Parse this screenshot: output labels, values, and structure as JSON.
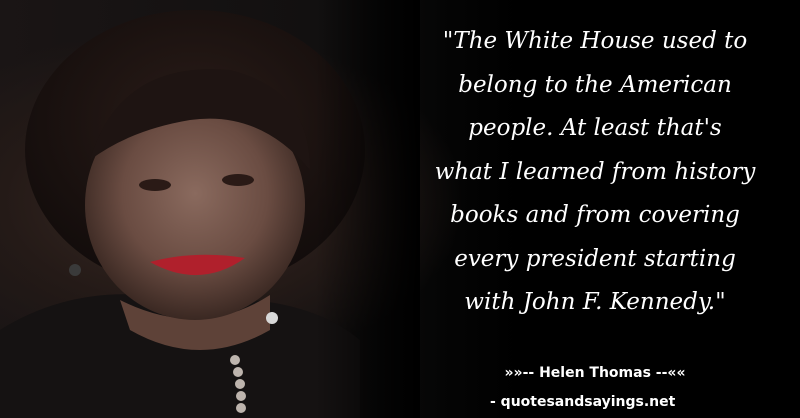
{
  "quote": {
    "lines": [
      "\"The White House used to",
      "belong to the American",
      "people. At least that's",
      "what I learned from history",
      "books and from covering",
      "every president starting",
      "with John F. Kennedy.\""
    ]
  },
  "attribution": {
    "author": "»»-- Helen Thomas --««",
    "source": "- quotesandsayings.net"
  },
  "colors": {
    "background": "#000000",
    "text": "#ffffff",
    "lips": "#b0202c"
  }
}
